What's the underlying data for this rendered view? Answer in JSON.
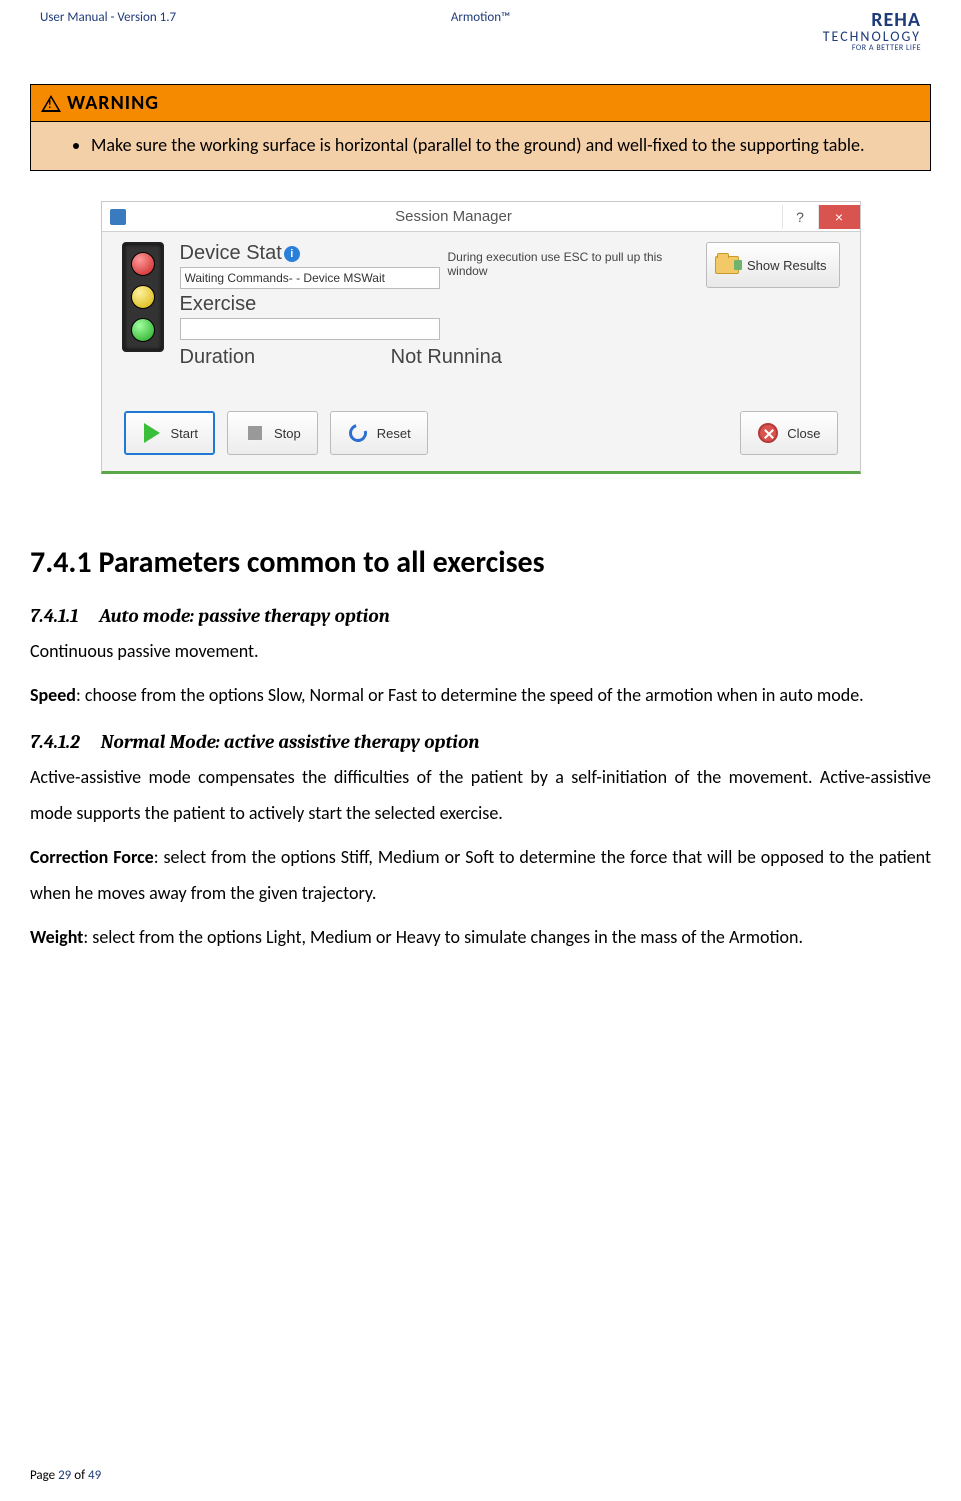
{
  "header": {
    "left": "User Manual - Version 1.7",
    "center": "Armotion™",
    "logo_line1": "REHA",
    "logo_line2": "TECHNOLOGY",
    "logo_line3": "FOR A BETTER LIFE"
  },
  "warning": {
    "label": "WARNING",
    "bullet": "Make sure the working surface is horizontal (parallel to the ground) and well-fixed to the supporting table."
  },
  "session_manager": {
    "title": "Session Manager",
    "help": "?",
    "close_glyph": "×",
    "device_status_label": "Device Stat",
    "device_status_value": "Waiting Commands- - Device MSWait",
    "hint": "During execution use ESC to pull up this window",
    "exercise_label": "Exercise",
    "exercise_value": "",
    "duration_label": "Duration",
    "not_running": "Not Runnina",
    "show_results": "Show Results",
    "buttons": {
      "start": "Start",
      "stop": "Stop",
      "reset": "Reset",
      "close": "Close"
    }
  },
  "sections": {
    "h2_num": "7.4.1",
    "h2_title": "Parameters common to all exercises",
    "s1_num": "7.4.1.1",
    "s1_title": "Auto mode: passive therapy option",
    "s1_p1": "Continuous passive movement.",
    "s1_p2a": "Speed",
    "s1_p2b": ": choose from the options Slow, Normal or Fast to determine the speed of the armotion when in auto mode.",
    "s2_num": "7.4.1.2",
    "s2_title": "Normal Mode: active assistive therapy option",
    "s2_p1": "Active-assistive mode compensates the difficulties of the patient by a self-initiation of the movement. Active-assistive mode supports the patient to actively start the selected exercise.",
    "s2_p2a": "Correction Force",
    "s2_p2b": ": select from the options Stiff, Medium or Soft to determine the force that will be opposed to the patient when he moves away from the given trajectory.",
    "s2_p3a": "Weight",
    "s2_p3b": ": select from the options Light, Medium or Heavy to simulate changes in the mass of the Armotion."
  },
  "footer": {
    "prefix": "Page ",
    "current": "29",
    "of": " of ",
    "total": "49"
  }
}
